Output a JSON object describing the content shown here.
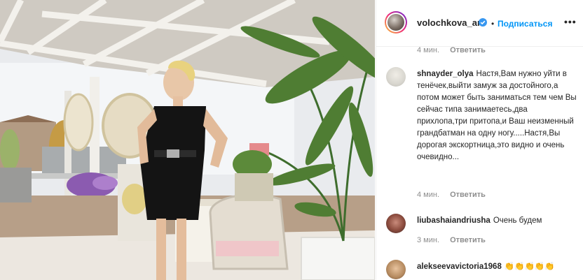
{
  "post": {
    "author": "volochkova_art",
    "follow_label": "Подписаться",
    "dot": "•",
    "more_label": "•••"
  },
  "comments": [
    {
      "time": "4 мин.",
      "reply_label": "Ответить"
    },
    {
      "username": "shnayder_olya",
      "text": "Настя,Вам нужно уйти в тенёчек,выйти замуж за достойного,а потом может быть заниматься тем чем Вы сейчас типа занимаетесь,два прихлопа,три притопа,и Ваш неизменный грандбатман на одну ногу.....Настя,Вы дорогая экскортница,это видно и очень очевидно...",
      "time": "4 мин.",
      "reply_label": "Ответить"
    },
    {
      "username": "liubashaiandriusha",
      "text": "Очень будем",
      "time": "3 мин.",
      "reply_label": "Ответить"
    },
    {
      "username": "alekseevavictoria1968",
      "text": "👏👏👏👏👏"
    }
  ],
  "colors": {
    "accent": "#0095f6",
    "verified": "#3897f0",
    "muted": "#8e8e8e",
    "text": "#262626"
  },
  "icons": {
    "verified": "verified-badge-icon",
    "more": "more-options-icon"
  }
}
